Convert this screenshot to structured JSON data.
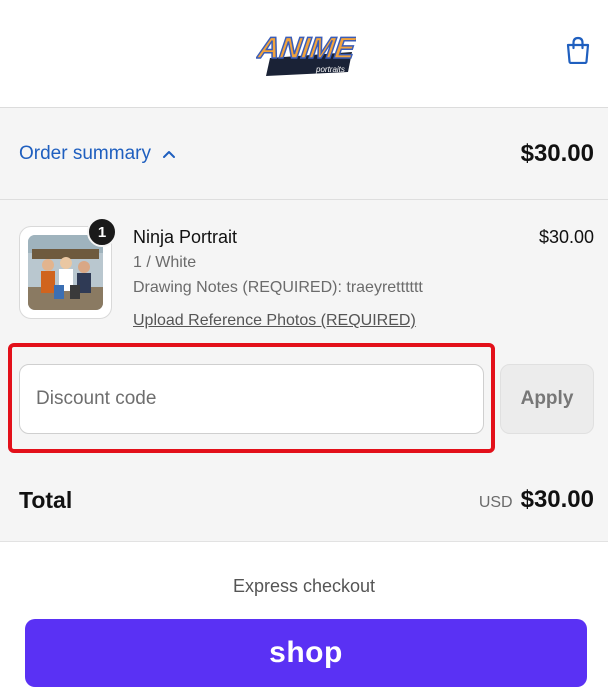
{
  "header": {
    "logo_text": "ANIME",
    "logo_subtext": "portraits",
    "cart_icon": "shopping-bag-icon"
  },
  "summary": {
    "toggle_label": "Order summary",
    "toggle_icon": "chevron-up-icon",
    "total_top": "$30.00"
  },
  "item": {
    "quantity": "1",
    "name": "Ninja Portrait",
    "variant": "1 / White",
    "notes": "Drawing Notes (REQUIRED): traeyretttttt",
    "upload_link": "Upload Reference Photos (REQUIRED)",
    "price": "$30.00"
  },
  "discount": {
    "placeholder": "Discount code",
    "value": "",
    "apply_label": "Apply"
  },
  "total": {
    "label": "Total",
    "currency": "USD",
    "amount": "$30.00"
  },
  "express": {
    "label": "Express checkout",
    "shop_label": "shop"
  },
  "colors": {
    "link_blue": "#1f5fbf",
    "shop_purple": "#5a31f4",
    "highlight_red": "#e3101a",
    "summary_bg": "#f5f5f5"
  }
}
